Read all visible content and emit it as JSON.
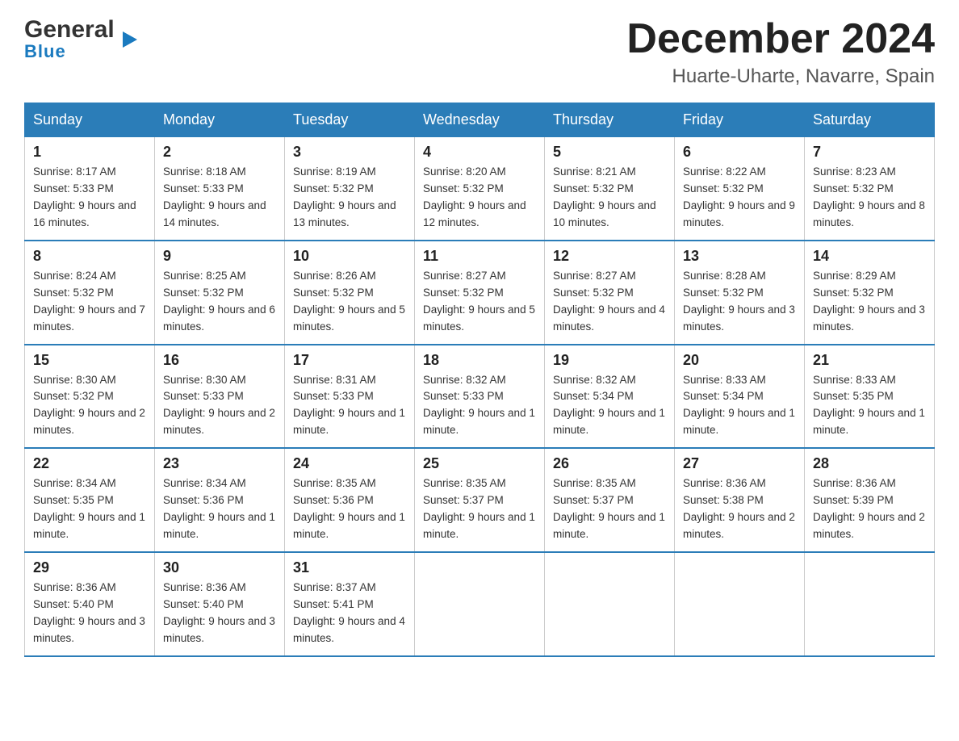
{
  "header": {
    "logo_general": "General",
    "logo_blue": "Blue",
    "title": "December 2024",
    "subtitle": "Huarte-Uharte, Navarre, Spain"
  },
  "weekdays": [
    "Sunday",
    "Monday",
    "Tuesday",
    "Wednesday",
    "Thursday",
    "Friday",
    "Saturday"
  ],
  "weeks": [
    [
      {
        "day": "1",
        "sunrise": "8:17 AM",
        "sunset": "5:33 PM",
        "daylight": "9 hours and 16 minutes."
      },
      {
        "day": "2",
        "sunrise": "8:18 AM",
        "sunset": "5:33 PM",
        "daylight": "9 hours and 14 minutes."
      },
      {
        "day": "3",
        "sunrise": "8:19 AM",
        "sunset": "5:32 PM",
        "daylight": "9 hours and 13 minutes."
      },
      {
        "day": "4",
        "sunrise": "8:20 AM",
        "sunset": "5:32 PM",
        "daylight": "9 hours and 12 minutes."
      },
      {
        "day": "5",
        "sunrise": "8:21 AM",
        "sunset": "5:32 PM",
        "daylight": "9 hours and 10 minutes."
      },
      {
        "day": "6",
        "sunrise": "8:22 AM",
        "sunset": "5:32 PM",
        "daylight": "9 hours and 9 minutes."
      },
      {
        "day": "7",
        "sunrise": "8:23 AM",
        "sunset": "5:32 PM",
        "daylight": "9 hours and 8 minutes."
      }
    ],
    [
      {
        "day": "8",
        "sunrise": "8:24 AM",
        "sunset": "5:32 PM",
        "daylight": "9 hours and 7 minutes."
      },
      {
        "day": "9",
        "sunrise": "8:25 AM",
        "sunset": "5:32 PM",
        "daylight": "9 hours and 6 minutes."
      },
      {
        "day": "10",
        "sunrise": "8:26 AM",
        "sunset": "5:32 PM",
        "daylight": "9 hours and 5 minutes."
      },
      {
        "day": "11",
        "sunrise": "8:27 AM",
        "sunset": "5:32 PM",
        "daylight": "9 hours and 5 minutes."
      },
      {
        "day": "12",
        "sunrise": "8:27 AM",
        "sunset": "5:32 PM",
        "daylight": "9 hours and 4 minutes."
      },
      {
        "day": "13",
        "sunrise": "8:28 AM",
        "sunset": "5:32 PM",
        "daylight": "9 hours and 3 minutes."
      },
      {
        "day": "14",
        "sunrise": "8:29 AM",
        "sunset": "5:32 PM",
        "daylight": "9 hours and 3 minutes."
      }
    ],
    [
      {
        "day": "15",
        "sunrise": "8:30 AM",
        "sunset": "5:32 PM",
        "daylight": "9 hours and 2 minutes."
      },
      {
        "day": "16",
        "sunrise": "8:30 AM",
        "sunset": "5:33 PM",
        "daylight": "9 hours and 2 minutes."
      },
      {
        "day": "17",
        "sunrise": "8:31 AM",
        "sunset": "5:33 PM",
        "daylight": "9 hours and 1 minute."
      },
      {
        "day": "18",
        "sunrise": "8:32 AM",
        "sunset": "5:33 PM",
        "daylight": "9 hours and 1 minute."
      },
      {
        "day": "19",
        "sunrise": "8:32 AM",
        "sunset": "5:34 PM",
        "daylight": "9 hours and 1 minute."
      },
      {
        "day": "20",
        "sunrise": "8:33 AM",
        "sunset": "5:34 PM",
        "daylight": "9 hours and 1 minute."
      },
      {
        "day": "21",
        "sunrise": "8:33 AM",
        "sunset": "5:35 PM",
        "daylight": "9 hours and 1 minute."
      }
    ],
    [
      {
        "day": "22",
        "sunrise": "8:34 AM",
        "sunset": "5:35 PM",
        "daylight": "9 hours and 1 minute."
      },
      {
        "day": "23",
        "sunrise": "8:34 AM",
        "sunset": "5:36 PM",
        "daylight": "9 hours and 1 minute."
      },
      {
        "day": "24",
        "sunrise": "8:35 AM",
        "sunset": "5:36 PM",
        "daylight": "9 hours and 1 minute."
      },
      {
        "day": "25",
        "sunrise": "8:35 AM",
        "sunset": "5:37 PM",
        "daylight": "9 hours and 1 minute."
      },
      {
        "day": "26",
        "sunrise": "8:35 AM",
        "sunset": "5:37 PM",
        "daylight": "9 hours and 1 minute."
      },
      {
        "day": "27",
        "sunrise": "8:36 AM",
        "sunset": "5:38 PM",
        "daylight": "9 hours and 2 minutes."
      },
      {
        "day": "28",
        "sunrise": "8:36 AM",
        "sunset": "5:39 PM",
        "daylight": "9 hours and 2 minutes."
      }
    ],
    [
      {
        "day": "29",
        "sunrise": "8:36 AM",
        "sunset": "5:40 PM",
        "daylight": "9 hours and 3 minutes."
      },
      {
        "day": "30",
        "sunrise": "8:36 AM",
        "sunset": "5:40 PM",
        "daylight": "9 hours and 3 minutes."
      },
      {
        "day": "31",
        "sunrise": "8:37 AM",
        "sunset": "5:41 PM",
        "daylight": "9 hours and 4 minutes."
      },
      null,
      null,
      null,
      null
    ]
  ]
}
